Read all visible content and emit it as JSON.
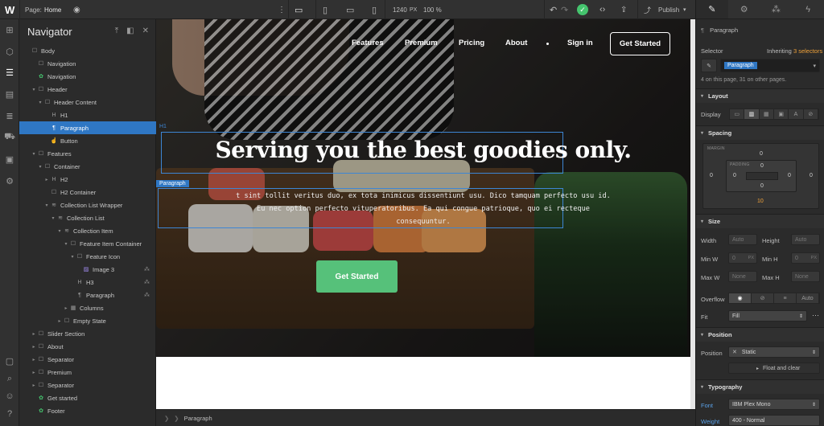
{
  "topbar": {
    "logo": "W",
    "page_label": "Page:",
    "page_name": "Home",
    "canvas_width": "1240",
    "canvas_unit": "PX",
    "zoom": "100 %",
    "publish_label": "Publish"
  },
  "navigator": {
    "title": "Navigator",
    "items": [
      {
        "label": "Body",
        "depth": 0,
        "icon": "box",
        "caret": ""
      },
      {
        "label": "Navigation",
        "depth": 1,
        "icon": "box",
        "caret": ""
      },
      {
        "label": "Navigation",
        "depth": 1,
        "icon": "symbol",
        "caret": ""
      },
      {
        "label": "Header",
        "depth": 1,
        "icon": "box",
        "caret": "▾"
      },
      {
        "label": "Header Content",
        "depth": 2,
        "icon": "box",
        "caret": "▾"
      },
      {
        "label": "H1",
        "depth": 3,
        "icon": "heading",
        "caret": ""
      },
      {
        "label": "Paragraph",
        "depth": 3,
        "icon": "para",
        "caret": "",
        "selected": true
      },
      {
        "label": "Button",
        "depth": 3,
        "icon": "link",
        "caret": ""
      },
      {
        "label": "Features",
        "depth": 1,
        "icon": "box",
        "caret": "▾"
      },
      {
        "label": "Container",
        "depth": 2,
        "icon": "box",
        "caret": "▾"
      },
      {
        "label": "H2",
        "depth": 3,
        "icon": "heading",
        "caret": "▸"
      },
      {
        "label": "H2 Container",
        "depth": 3,
        "icon": "box",
        "caret": ""
      },
      {
        "label": "Collection List Wrapper",
        "depth": 3,
        "icon": "stack",
        "caret": "▾"
      },
      {
        "label": "Collection List",
        "depth": 4,
        "icon": "stack",
        "caret": "▾"
      },
      {
        "label": "Collection Item",
        "depth": 5,
        "icon": "stack",
        "caret": "▾"
      },
      {
        "label": "Feature Item Container",
        "depth": 6,
        "icon": "box",
        "caret": "▾"
      },
      {
        "label": "Feature Icon",
        "depth": 7,
        "icon": "box",
        "caret": "▾"
      },
      {
        "label": "Image 3",
        "depth": 8,
        "icon": "image",
        "caret": "",
        "extra": "⁂"
      },
      {
        "label": "H3",
        "depth": 7,
        "icon": "heading",
        "caret": "",
        "extra": "⁂"
      },
      {
        "label": "Paragraph",
        "depth": 7,
        "icon": "para",
        "caret": "",
        "extra": "⁂"
      },
      {
        "label": "Columns",
        "depth": 6,
        "icon": "grid",
        "caret": "▸"
      },
      {
        "label": "Empty State",
        "depth": 5,
        "icon": "box",
        "caret": "▸"
      },
      {
        "label": "Slider Section",
        "depth": 1,
        "icon": "box",
        "caret": "▸"
      },
      {
        "label": "About",
        "depth": 1,
        "icon": "box",
        "caret": "▸"
      },
      {
        "label": "Separator",
        "depth": 1,
        "icon": "box",
        "caret": "▸"
      },
      {
        "label": "Premium",
        "depth": 1,
        "icon": "box",
        "caret": "▸"
      },
      {
        "label": "Separator",
        "depth": 1,
        "icon": "box",
        "caret": "▸"
      },
      {
        "label": "Get started",
        "depth": 1,
        "icon": "symbol",
        "caret": ""
      },
      {
        "label": "Footer",
        "depth": 1,
        "icon": "symbol",
        "caret": ""
      }
    ]
  },
  "site": {
    "nav": [
      "Features",
      "Premium",
      "Pricing",
      "About",
      "Sign in"
    ],
    "cta": "Get Started",
    "headline": "Serving you the best goodies only.",
    "paragraph_line1": "t sint tollit veritus duo, ex tota inimicus dissentiunt usu. Dico tamquam perfecto usu id.",
    "paragraph_line2": "Eu nec option perfecto vituperatoribus. Ea qui congue patrioque, quo ei recteque",
    "paragraph_line3": "consequuntur.",
    "button": "Get Started",
    "h1_tag": "H1",
    "paragraph_tag": "Paragraph"
  },
  "breadcrumb": {
    "item": "Paragraph"
  },
  "panel": {
    "element_label": "Paragraph",
    "selector_label": "Selector",
    "inheriting_prefix": "Inheriting",
    "inheriting_count": "3 selectors",
    "selector_chip": "Paragraph",
    "usage_note": "4 on this page, 31 on other pages.",
    "layout": {
      "title": "Layout",
      "display_label": "Display"
    },
    "spacing": {
      "title": "Spacing",
      "margin_label": "MARGIN",
      "padding_label": "PADDING",
      "margin": {
        "top": "0",
        "right": "0",
        "bottom": "10",
        "left": "0"
      },
      "padding": {
        "top": "0",
        "right": "0",
        "bottom": "0",
        "left": "0"
      }
    },
    "size": {
      "title": "Size",
      "width_label": "Width",
      "width_value": "Auto",
      "height_label": "Height",
      "height_value": "Auto",
      "minw_label": "Min W",
      "minw_value": "0",
      "minw_unit": "PX",
      "minh_label": "Min H",
      "minh_value": "0",
      "minh_unit": "PX",
      "maxw_label": "Max W",
      "maxw_value": "None",
      "maxh_label": "Max H",
      "maxh_value": "None",
      "overflow_label": "Overflow",
      "overflow_auto": "Auto",
      "fit_label": "Fit",
      "fit_value": "Fill"
    },
    "position": {
      "title": "Position",
      "position_label": "Position",
      "position_value": "Static",
      "float_label": "Float and clear"
    },
    "typography": {
      "title": "Typography",
      "font_label": "Font",
      "font_value": "IBM Plex Mono",
      "weight_label": "Weight",
      "weight_value": "400 - Normal"
    }
  },
  "colors": {
    "selection": "#2f77c4",
    "accent_green": "#56c17a",
    "inherit_orange": "#f0a23a"
  }
}
